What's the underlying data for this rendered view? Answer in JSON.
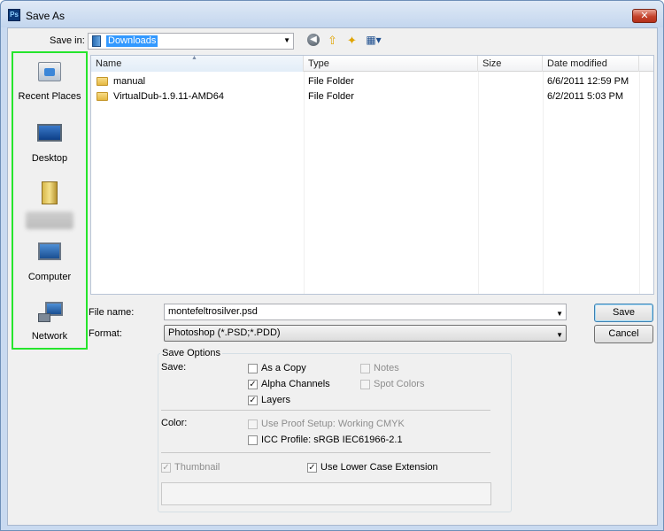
{
  "window": {
    "title": "Save As",
    "app_icon": "Ps",
    "close_glyph": "✕"
  },
  "toolbar": {
    "save_in_label": "Save in:",
    "save_in_value": "Downloads",
    "icons": [
      "back-icon",
      "up-folder-icon",
      "new-folder-icon",
      "view-menu-icon"
    ]
  },
  "places": [
    {
      "label": "Recent Places",
      "icon": "recent-places-icon"
    },
    {
      "label": "Desktop",
      "icon": "desktop-icon"
    },
    {
      "label": "",
      "icon": "user-folder-icon",
      "redacted": true
    },
    {
      "label": "Computer",
      "icon": "computer-icon"
    },
    {
      "label": "Network",
      "icon": "network-icon"
    }
  ],
  "file_list": {
    "columns": [
      "Name",
      "Type",
      "Size",
      "Date modified"
    ],
    "rows": [
      {
        "name": "manual",
        "type": "File Folder",
        "size": "",
        "date": "6/6/2011 12:59 PM"
      },
      {
        "name": "VirtualDub-1.9.11-AMD64",
        "type": "File Folder",
        "size": "",
        "date": "6/2/2011 5:03 PM"
      }
    ]
  },
  "form": {
    "filename_label": "File name:",
    "filename_value": "montefeltrosilver.psd",
    "format_label": "Format:",
    "format_value": "Photoshop (*.PSD;*.PDD)",
    "save_button": "Save",
    "cancel_button": "Cancel"
  },
  "options": {
    "title": "Save Options",
    "save_label": "Save:",
    "color_label": "Color:",
    "as_copy": {
      "label": "As a Copy",
      "checked": false,
      "enabled": true
    },
    "alpha": {
      "label": "Alpha Channels",
      "checked": true,
      "enabled": true
    },
    "layers": {
      "label": "Layers",
      "checked": true,
      "enabled": true
    },
    "notes": {
      "label": "Notes",
      "checked": false,
      "enabled": false
    },
    "spot": {
      "label": "Spot Colors",
      "checked": false,
      "enabled": false
    },
    "proof": {
      "label": "Use Proof Setup:  Working CMYK",
      "checked": false,
      "enabled": false
    },
    "icc": {
      "label": "ICC Profile:  sRGB IEC61966-2.1",
      "checked": false,
      "enabled": true
    },
    "thumbnail": {
      "label": "Thumbnail",
      "checked": true,
      "enabled": false
    },
    "lowercase": {
      "label": "Use Lower Case Extension",
      "checked": true,
      "enabled": true
    }
  },
  "colors": {
    "places_highlight": "#25e52c",
    "selection": "#3399ff",
    "close_button": "#c4432c"
  }
}
